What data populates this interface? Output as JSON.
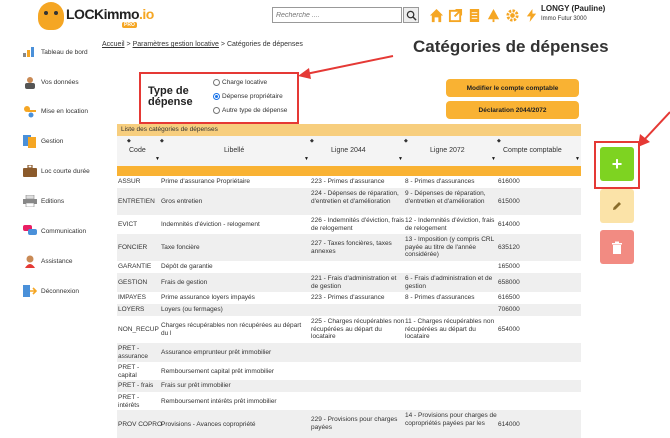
{
  "header": {
    "logo_text": "LOCKimmo",
    "logo_suffix": ".io",
    "logo_badge": "PRO",
    "search_placeholder": "Recherche ....",
    "icons": [
      "home-icon",
      "external-link-icon",
      "document-icon",
      "tree-icon",
      "gear-icon",
      "lightning-icon"
    ],
    "user_name": "LONGY (Pauline)",
    "user_company": "Immo Futur 3000"
  },
  "sidebar": {
    "items": [
      {
        "label": "Tableau de bord",
        "icon": "dashboard-icon"
      },
      {
        "label": "Vos données",
        "icon": "user-icon"
      },
      {
        "label": "Mise en location",
        "icon": "keys-icon"
      },
      {
        "label": "Gestion",
        "icon": "documents-icon"
      },
      {
        "label": "Loc courte durée",
        "icon": "suitcase-icon"
      },
      {
        "label": "Editions",
        "icon": "print-icon"
      },
      {
        "label": "Communication",
        "icon": "chat-icon"
      },
      {
        "label": "Assistance",
        "icon": "assistance-icon"
      },
      {
        "label": "Déconnexion",
        "icon": "logout-icon"
      }
    ]
  },
  "breadcrumb": {
    "home": "Accueil",
    "sep1": " > ",
    "level1": "Paramètres gestion locative",
    "sep2": " > ",
    "current": "Catégories de dépenses"
  },
  "page_title": "Catégories de dépenses",
  "type_depense": {
    "title": "Type de dépense",
    "options": [
      {
        "label": "Charge locative",
        "selected": false
      },
      {
        "label": "Dépense propriétaire",
        "selected": true
      },
      {
        "label": "Autre type de dépense",
        "selected": false
      }
    ]
  },
  "buttons": {
    "modify_account": "Modifier le compte comptable",
    "declaration": "Déclaration 2044/2072"
  },
  "table": {
    "title": "Liste des catégories de dépenses",
    "columns": [
      "Code",
      "Libellé",
      "Ligne 2044",
      "Ligne 2072",
      "Compte comptable"
    ],
    "rows": [
      [
        "ASSUR",
        "Prime d'assurance Propriétaire",
        "223 - Primes d'assurance",
        "8 - Primes d'assurances",
        "616000"
      ],
      [
        "ENTRETIEN",
        "Gros entretien",
        "224 - Dépenses de réparation, d'entretien et d'amélioration",
        "9 - Dépenses de réparation, d'entretien et d'amélioration",
        "615000"
      ],
      [
        "EVICT",
        "Indemnités d'éviction - relogement",
        "226 - Indemnités d'éviction, frais de relogement",
        "12 - Indemnités d'éviction, frais de relogement",
        "614000"
      ],
      [
        "FONCIER",
        "Taxe foncière",
        "227 - Taxes foncières, taxes annexes",
        "13 - Imposition (y compris CRL payée au titre de l'année considérée)",
        "635120"
      ],
      [
        "GARANTIE",
        "Dépôt de garantie",
        "",
        "",
        "165000"
      ],
      [
        "GESTION",
        "Frais de gestion",
        "221 - Frais d'administration et de gestion",
        "6 - Frais d'administration et de gestion",
        "658000"
      ],
      [
        "IMPAYES",
        "Prime assurance loyers impayés",
        "223 - Primes d'assurance",
        "8 - Primes d'assurances",
        "616500"
      ],
      [
        "LOYERS",
        "Loyers (ou fermages)",
        "",
        "",
        "706000"
      ],
      [
        "NON_RECUP",
        "Charges récupérables non récupérées au départ du l",
        "225 - Charges récupérables non récupérées au départ du locataire",
        "11 - Charges récupérables non récupérées au départ du locataire",
        "654000"
      ],
      [
        "PRET - assurance",
        "Assurance emprunteur prêt immobilier",
        "",
        "",
        ""
      ],
      [
        "PRET - capital",
        "Remboursement capital prêt immobilier",
        "",
        "",
        ""
      ],
      [
        "PRET - frais",
        "Frais sur prêt immobilier",
        "",
        "",
        ""
      ],
      [
        "PRET - intérêts",
        "Remboursement intérêts prêt immobilier",
        "",
        "",
        ""
      ],
      [
        "PROV COPRO",
        "Provisions - Avances copropriété",
        "229 - Provisions pour charges payées",
        "14 - Provisions pour charges de copropriétés payées par les",
        "614000"
      ]
    ]
  },
  "actions": {
    "add_label": "+",
    "edit_icon": "pencil-icon",
    "delete_icon": "trash-icon"
  },
  "colors": {
    "accent_orange": "#f9b233",
    "header_table": "#f7ce7e",
    "add_green": "#7ed321",
    "highlight_red": "#e53935",
    "delete_red": "#f28b82",
    "edit_yellow": "#fbe3a8"
  }
}
